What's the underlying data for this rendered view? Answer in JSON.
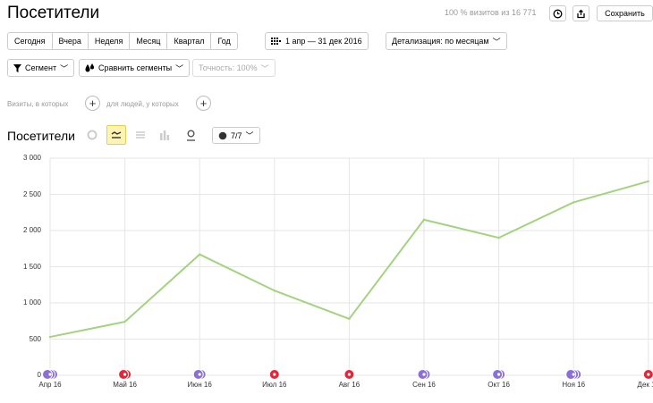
{
  "header": {
    "title": "Посетители",
    "visits_note": "100 % визитов из 16 771",
    "save_label": "Сохранить"
  },
  "periods": [
    "Сегодня",
    "Вчера",
    "Неделя",
    "Месяц",
    "Квартал",
    "Год"
  ],
  "date_range": "1 апр — 31 дек 2016",
  "detail": "Детализация: по месяцам",
  "segment_bar": {
    "segment": "Сегмент",
    "compare": "Сравнить сегменты",
    "accuracy": "Точность: 100%"
  },
  "filters": {
    "visits_label": "Визиты, в которых",
    "people_label": "для людей, у которых"
  },
  "chart_header": {
    "title": "Посетители",
    "metrics_count": "7/7"
  },
  "colors": {
    "line": "#a3d37f",
    "grid": "#e6e6e6",
    "marker_purple": "#8c6fd6",
    "marker_red": "#e0283a",
    "active_type_bg": "#fff3b3"
  },
  "chart_data": {
    "type": "line",
    "categories": [
      "Апр 16",
      "Май 16",
      "Июн 16",
      "Июл 16",
      "Авг 16",
      "Сен 16",
      "Окт 16",
      "Ноя 16",
      "Дек 16"
    ],
    "series": [
      {
        "values": [
          530,
          740,
          1670,
          1170,
          780,
          2150,
          1900,
          2390,
          2680
        ]
      }
    ],
    "yticks": [
      "0",
      "500",
      "1 000",
      "1 500",
      "2 000",
      "2 500",
      "3 000"
    ],
    "ylim": [
      0,
      3000
    ],
    "grid": true,
    "annotation_markers": [
      {
        "month": "Апр 16",
        "color": "purple",
        "count": 3
      },
      {
        "month": "Май 16",
        "color": "red",
        "count": 2
      },
      {
        "month": "Июн 16",
        "color": "purple",
        "count": 2
      },
      {
        "month": "Июл 16",
        "color": "red",
        "count": 1
      },
      {
        "month": "Авг 16",
        "color": "red",
        "count": 1
      },
      {
        "month": "Сен 16",
        "color": "purple",
        "count": 2
      },
      {
        "month": "Окт 16",
        "color": "purple",
        "count": 2
      },
      {
        "month": "Ноя 16",
        "color": "purple",
        "count": 3
      },
      {
        "month": "Дек 16",
        "color": "red",
        "count": 1
      }
    ]
  }
}
